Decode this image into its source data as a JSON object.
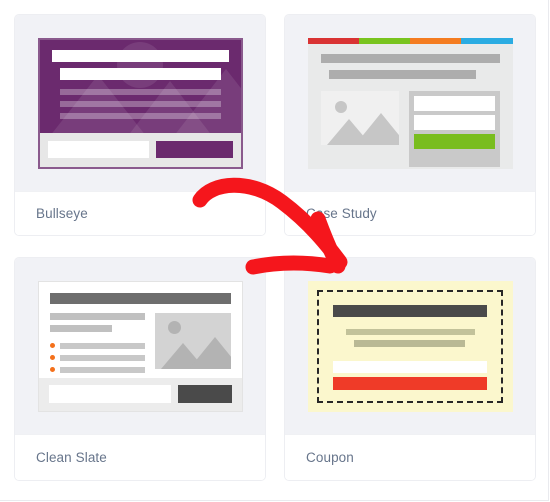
{
  "page": {
    "background": "#ffffff",
    "panel_border_color": "#e9eaee"
  },
  "annotation": {
    "type": "arrow",
    "color": "#f5161c",
    "description": "red curved arrow pointing to the Coupon template",
    "points_to": "Coupon"
  },
  "template_grid": {
    "columns": 2,
    "rows": 2,
    "cards": [
      {
        "label": "Bullseye",
        "selected": false,
        "thumbnail_background": "#f1f2f6",
        "mock": {
          "style": "bullseye",
          "canvas_color": "#6b2a6e",
          "border_color": "#8a5a8d",
          "heading_color": "#ffffff",
          "text_line_color": "rgba(255,255,255,.30)",
          "footer_color": "#e7e7e7",
          "input_color": "#ffffff",
          "button_color": "#6b2a6e",
          "art": "circle-and-triangles",
          "text_lines": 3
        }
      },
      {
        "label": "Case Study",
        "selected": false,
        "thumbnail_background": "#f1f2f6",
        "mock": {
          "style": "case-study",
          "canvas_color": "#e9eaea",
          "top_bar_colors": [
            "#d93333",
            "#79c41e",
            "#f47c20",
            "#2bace2"
          ],
          "heading_color": "#adadad",
          "image_placeholder_color": "#f0f0f0",
          "image_shape_color": "#c6c6c6",
          "form_background": "#c9c9c9",
          "input_color": "#ffffff",
          "button_color": "#79bd1e",
          "headings": 2,
          "inputs": 2
        }
      },
      {
        "label": "Clean Slate",
        "selected": false,
        "thumbnail_background": "#f1f2f6",
        "mock": {
          "style": "clean-slate",
          "canvas_color": "#ffffff",
          "border_color": "#e3e3e3",
          "heading_color": "#6e6e6e",
          "subtext_color": "#c0c0c0",
          "bullet_color": "#f4701b",
          "bullet_count": 3,
          "image_placeholder_color": "#d3d3d3",
          "image_shape_color": "#b3b3b3",
          "footer_color": "#ececec",
          "input_color": "#ffffff",
          "button_color": "#4a4a4a"
        }
      },
      {
        "label": "Coupon",
        "selected": true,
        "thumbnail_background": "#f1f2f6",
        "mock": {
          "style": "coupon",
          "canvas_color": "#fbf7cd",
          "dashed_border_color": "#272727",
          "heading_color": "#4a4a4a",
          "text_line_colors": [
            "#c2c29a",
            "#b9b995"
          ],
          "input_color": "#ffffff",
          "button_color": "#ef3b28"
        }
      }
    ]
  }
}
